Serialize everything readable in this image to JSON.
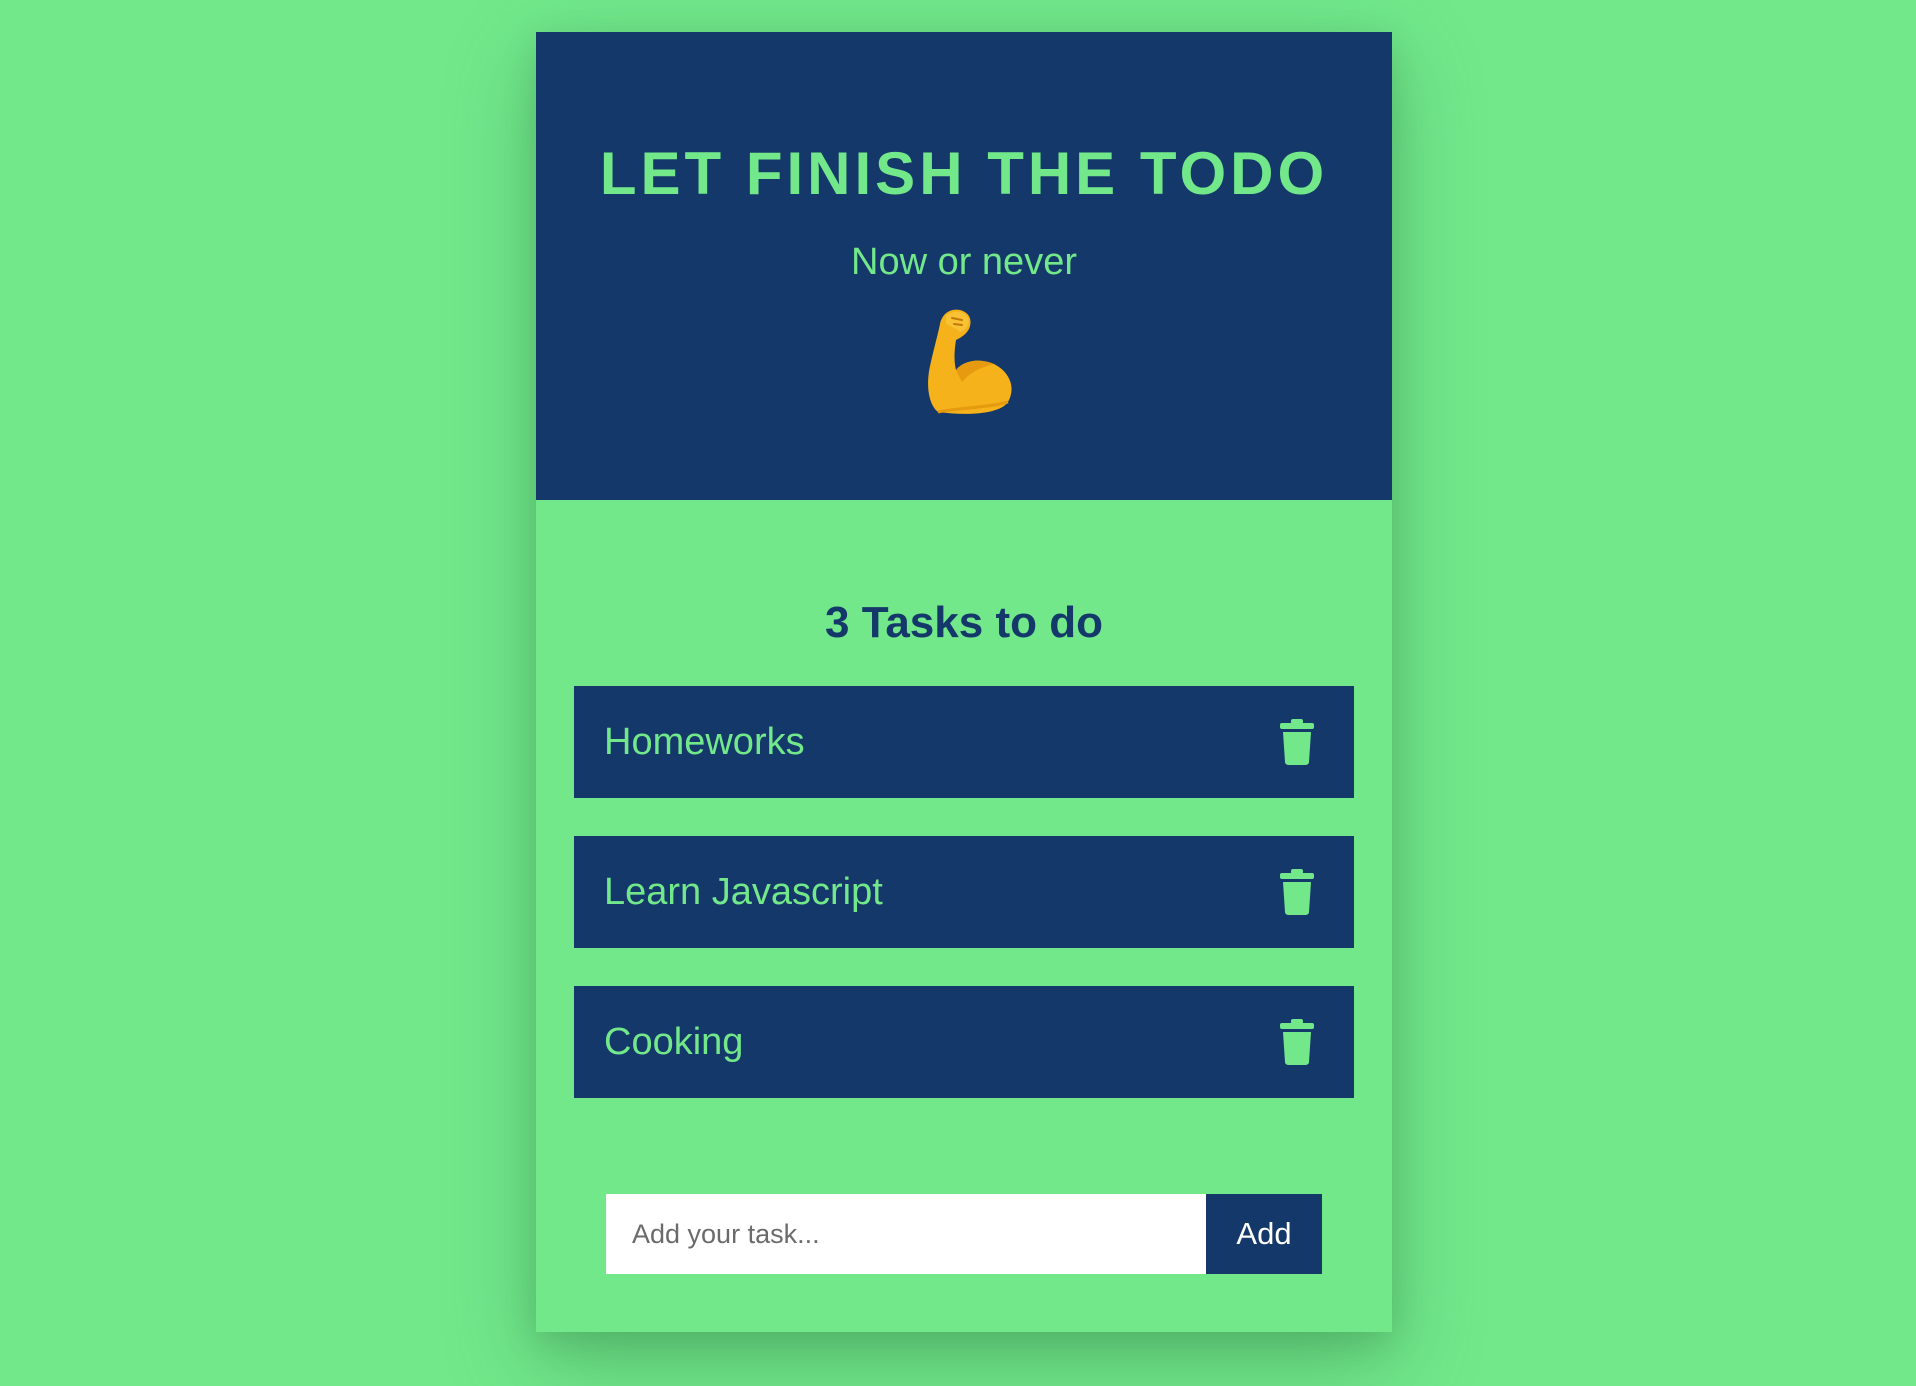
{
  "header": {
    "title": "LET FINISH THE TODO",
    "subtitle": "Now or never",
    "emoji_icon": "flexed-biceps-icon"
  },
  "summary": {
    "task_count_text": "3 Tasks to do"
  },
  "tasks": [
    {
      "label": "Homeworks",
      "delete_icon": "trash-icon"
    },
    {
      "label": "Learn Javascript",
      "delete_icon": "trash-icon"
    },
    {
      "label": "Cooking",
      "delete_icon": "trash-icon"
    }
  ],
  "form": {
    "input_placeholder": "Add your task...",
    "input_value": "",
    "add_label": "Add"
  },
  "colors": {
    "background": "#72e88b",
    "primary": "#15386a",
    "button_text": "#ffffff"
  }
}
